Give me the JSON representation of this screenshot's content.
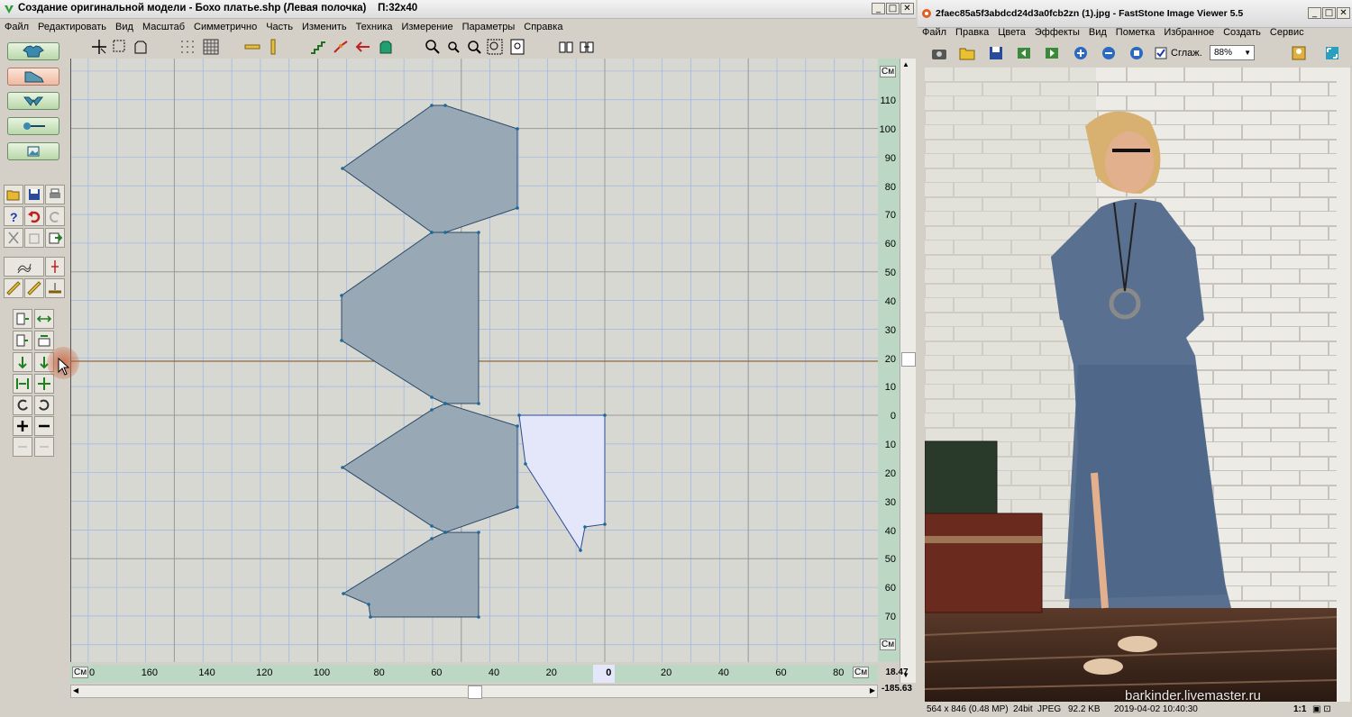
{
  "left_window": {
    "title": "Создание оригинальной модели - Бохо платье.shp (Левая полочка)",
    "size_label": "П:32x40",
    "menu": [
      "Файл",
      "Редактировать",
      "Вид",
      "Масштаб",
      "Симметрично",
      "Часть",
      "Изменить",
      "Техника",
      "Измерение",
      "Параметры",
      "Справка"
    ],
    "vruler_unit": "См",
    "vruler_ticks": [
      "110",
      "100",
      "90",
      "80",
      "70",
      "60",
      "50",
      "40",
      "30",
      "20",
      "10",
      "0",
      "10",
      "20",
      "30",
      "40",
      "50",
      "60",
      "70"
    ],
    "hruler_unit": "См",
    "hruler_ticks": [
      "0",
      "160",
      "140",
      "120",
      "100",
      "80",
      "60",
      "40",
      "20",
      "0",
      "20",
      "40",
      "60",
      "80"
    ],
    "coord_x": "18.47",
    "coord_y": "-185.63"
  },
  "right_window": {
    "title": "2faec85a5f3abdcd24d3a0fcb2zn (1).jpg - FastStone Image Viewer 5.5",
    "menu": [
      "Файл",
      "Правка",
      "Цвета",
      "Эффекты",
      "Вид",
      "Пометка",
      "Избранное",
      "Создать",
      "Сервис"
    ],
    "smooth_label": "Сглаж.",
    "smooth_checked": true,
    "zoom": "88%",
    "status": {
      "dimensions": "564 x 846 (0.48 MP)",
      "bitdepth": "24bit",
      "format": "JPEG",
      "filesize": "92.2 KB",
      "datetime": "2019-04-02 10:40:30",
      "ratio": "1:1"
    },
    "watermark": "barkinder.livemaster.ru"
  },
  "colors": {
    "pattern_fill": "#98a8b4",
    "selected_fill": "#e4e6fa",
    "grid_minor": "#9db4e8",
    "grid_major": "#9a9a9a",
    "ruler_bg": "#bcd8c4"
  }
}
